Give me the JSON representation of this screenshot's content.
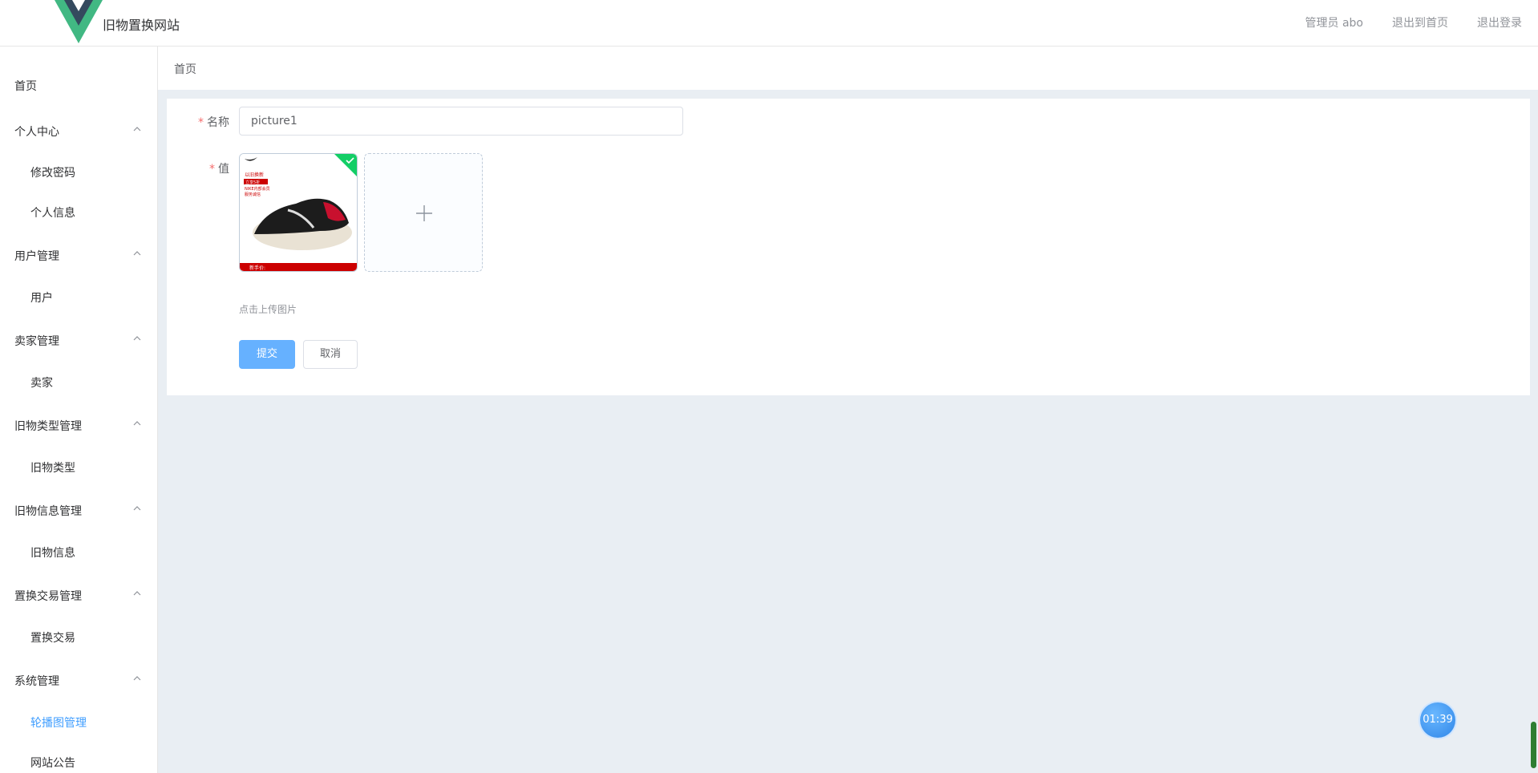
{
  "app": {
    "title": "旧物置换网站"
  },
  "header": {
    "links": [
      "管理员 abo",
      "退出到首页",
      "退出登录"
    ]
  },
  "sidebar": {
    "groups": [
      {
        "label": "首页",
        "children": []
      },
      {
        "label": "个人中心",
        "children": [
          "修改密码",
          "个人信息"
        ]
      },
      {
        "label": "用户管理",
        "children": [
          "用户"
        ]
      },
      {
        "label": "卖家管理",
        "children": [
          "卖家"
        ]
      },
      {
        "label": "旧物类型管理",
        "children": [
          "旧物类型"
        ]
      },
      {
        "label": "旧物信息管理",
        "children": [
          "旧物信息"
        ]
      },
      {
        "label": "置换交易管理",
        "children": [
          "置换交易"
        ]
      },
      {
        "label": "系统管理",
        "children": [
          "轮播图管理",
          "网站公告"
        ]
      }
    ],
    "active_item": "轮播图管理"
  },
  "breadcrumb": {
    "label": "首页"
  },
  "form": {
    "name_label": "名称",
    "name_value": "picture1",
    "value_label": "值",
    "upload_hint": "点击上传图片",
    "thumb_texts": [
      "以旧换新",
      "立享5折",
      "NIKE内部会员",
      "服务诚信",
      "新手价:"
    ],
    "submit_label": "提交",
    "cancel_label": "取消"
  },
  "timer": {
    "label": "01:39"
  },
  "colors": {
    "accent": "#409eff",
    "required": "#f56c6c",
    "success": "#13ce66",
    "logo_green": "#41b883",
    "logo_dark": "#34495e"
  }
}
